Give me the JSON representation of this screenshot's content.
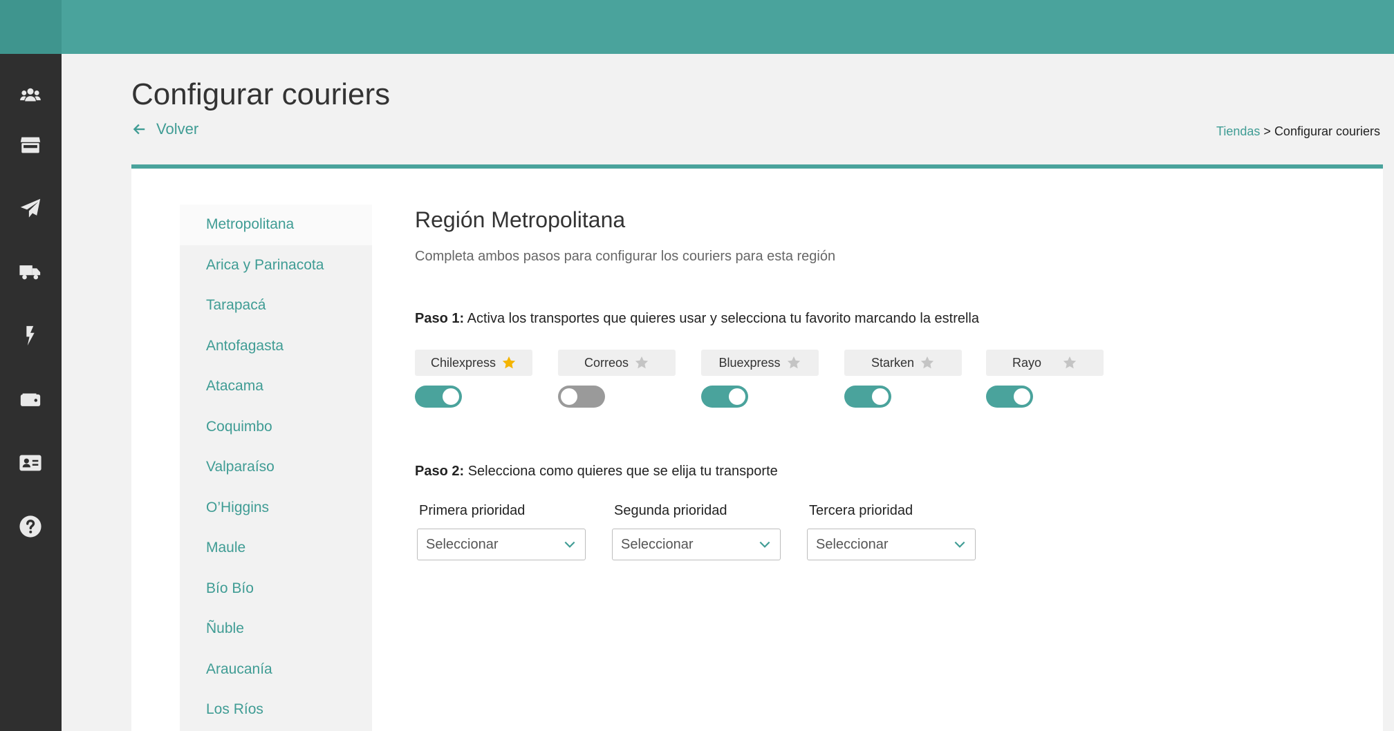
{
  "page": {
    "title": "Configurar couriers",
    "back_label": "Volver"
  },
  "breadcrumb": {
    "link": "Tiendas",
    "separator": " > ",
    "current": "Configurar couriers"
  },
  "sidebar": {
    "icons": [
      "users-icon",
      "store-icon",
      "paper-plane-icon",
      "truck-icon",
      "bolt-icon",
      "wallet-icon",
      "id-card-icon",
      "help-icon"
    ]
  },
  "regions": [
    "Metropolitana",
    "Arica y Parinacota",
    "Tarapacá",
    "Antofagasta",
    "Atacama",
    "Coquimbo",
    "Valparaíso",
    "O’Higgins",
    "Maule",
    "Bío Bío",
    "Ñuble",
    "Araucanía",
    "Los Ríos"
  ],
  "region": {
    "title": "Región Metropolitana",
    "description": "Completa ambos pasos para configurar los couriers para esta región"
  },
  "step1": {
    "label": "Paso 1:",
    "text": " Activa los transportes que quieres usar y selecciona tu favorito marcando la estrella"
  },
  "couriers": [
    {
      "name": "Chilexpress",
      "favorite": true,
      "enabled": true
    },
    {
      "name": "Correos",
      "favorite": false,
      "enabled": false
    },
    {
      "name": "Bluexpress",
      "favorite": false,
      "enabled": true
    },
    {
      "name": "Starken",
      "favorite": false,
      "enabled": true
    },
    {
      "name": "Rayo",
      "favorite": false,
      "enabled": true
    }
  ],
  "step2": {
    "label": "Paso 2:",
    "text": " Selecciona como quieres que se elija tu transporte"
  },
  "priorities": [
    {
      "label": "Primera prioridad",
      "value": "Seleccionar"
    },
    {
      "label": "Segunda prioridad",
      "value": "Seleccionar"
    },
    {
      "label": "Tercera prioridad",
      "value": "Seleccionar"
    }
  ],
  "colors": {
    "accent": "#4aa39c",
    "sidebar": "#2f2f2f",
    "star_active": "#f4b400",
    "star_inactive": "#c4c4c4"
  }
}
